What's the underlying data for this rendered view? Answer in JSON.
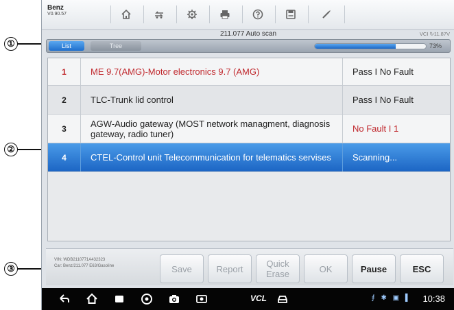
{
  "callouts": {
    "one": "①",
    "two": "②",
    "three": "③"
  },
  "toolbar": {
    "brand": "Benz",
    "version": "V0.90.57",
    "icons": [
      "home-icon",
      "vehicle-swap-icon",
      "settings-gear-icon",
      "print-icon",
      "help-icon",
      "save-icon",
      "pen-icon"
    ]
  },
  "scan": {
    "title": "211.077 Auto scan",
    "vci_battery": "VCI  ↻11.87V"
  },
  "tabs": {
    "list": "List",
    "tree": "Tree",
    "active": "List"
  },
  "progress": {
    "value": 0.73,
    "label": "73%"
  },
  "modules": [
    {
      "num": "1",
      "name": "ME 9.7(AMG)-Motor electronics 9.7 (AMG)",
      "status": "Pass I No Fault",
      "name_color": "#c0282d",
      "status_color": "#222222"
    },
    {
      "num": "2",
      "name": "TLC-Trunk lid control",
      "status": "Pass I No Fault",
      "name_color": "#222222",
      "status_color": "#222222"
    },
    {
      "num": "3",
      "name": "AGW-Audio gateway (MOST network managment, diagnosis gateway, radio tuner)",
      "status": "No Fault I 1",
      "name_color": "#222222",
      "status_color": "#c0282d"
    },
    {
      "num": "4",
      "name": "CTEL-Control unit Telecommunication for telematics servises",
      "status": "Scanning...",
      "selected": true
    }
  ],
  "vehicle": {
    "vin": "VIN: WDB2110771A432323",
    "car": "Car: Benz/211.077 E63/Gasoline"
  },
  "buttons": {
    "save": "Save",
    "report": "Report",
    "quick_erase": "Quick Erase",
    "ok": "OK",
    "pause": "Pause",
    "esc": "ESC"
  },
  "statusbar": {
    "vcl": "VCL",
    "time": "10:38",
    "sys_icons": "⨎ ✱ ▣ ▌"
  }
}
